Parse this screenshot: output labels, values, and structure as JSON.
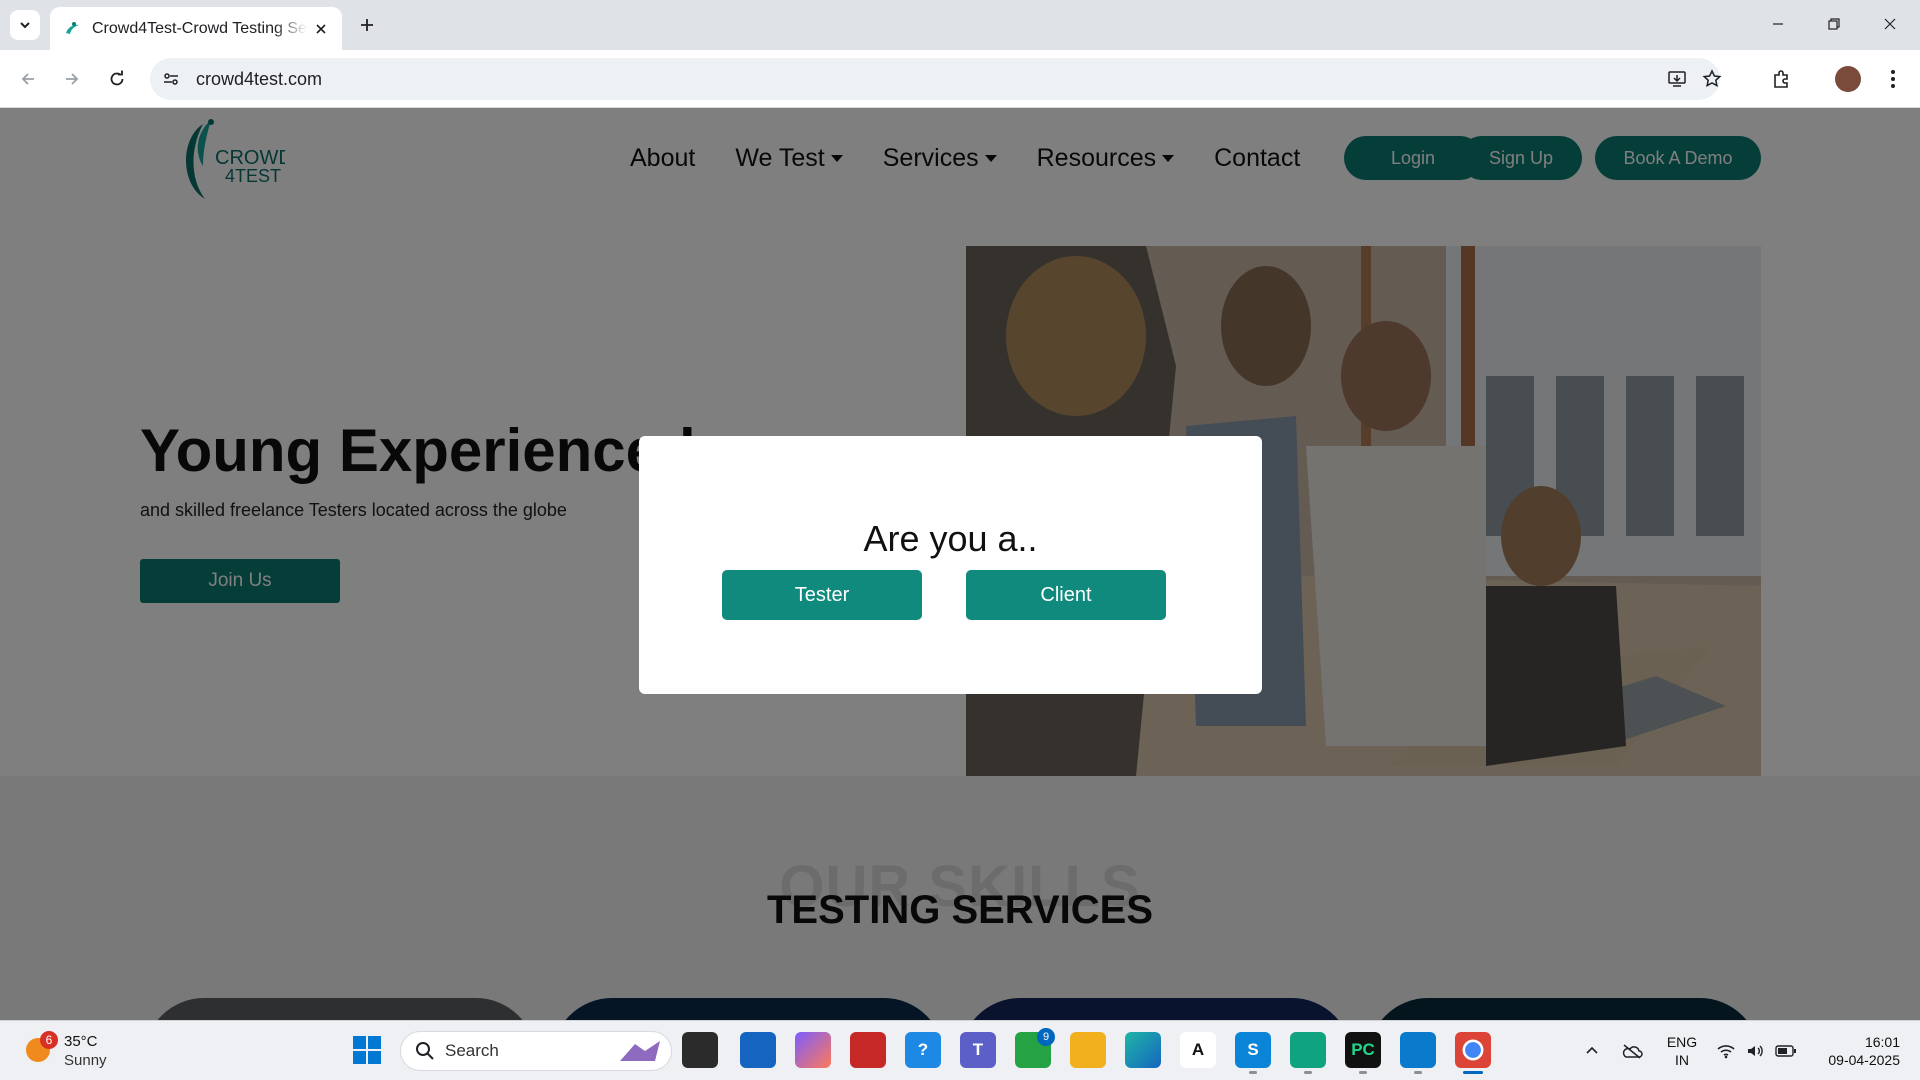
{
  "browser": {
    "tab_title": "Crowd4Test-Crowd Testing Services",
    "url": "crowd4test.com"
  },
  "site": {
    "logo_text": [
      "CROWD",
      "4TEST"
    ],
    "nav": [
      {
        "label": "About",
        "dropdown": false
      },
      {
        "label": "We Test",
        "dropdown": true
      },
      {
        "label": "Services",
        "dropdown": true
      },
      {
        "label": "Resources",
        "dropdown": true
      },
      {
        "label": "Contact",
        "dropdown": false
      }
    ],
    "login_label": "Login",
    "signup_label": "Sign Up",
    "demo_label": "Book A Demo",
    "accent_color": "#0b7b71"
  },
  "hero": {
    "title": "Young Experienced",
    "subtitle": "and skilled freelance Testers located across the globe",
    "cta_label": "Join Us"
  },
  "skills": {
    "bg_text": "OUR SKILLS",
    "title": "TESTING SERVICES"
  },
  "modal": {
    "question": "Are you a..",
    "tester_label": "Tester",
    "client_label": "Client"
  },
  "taskbar": {
    "weather_temp": "35°C",
    "weather_condition": "Sunny",
    "weather_badge": "6",
    "search_label": "Search",
    "whatsapp_badge": "9",
    "lang_line1": "ENG",
    "lang_line2": "IN",
    "time": "16:01",
    "date": "09-04-2025"
  }
}
